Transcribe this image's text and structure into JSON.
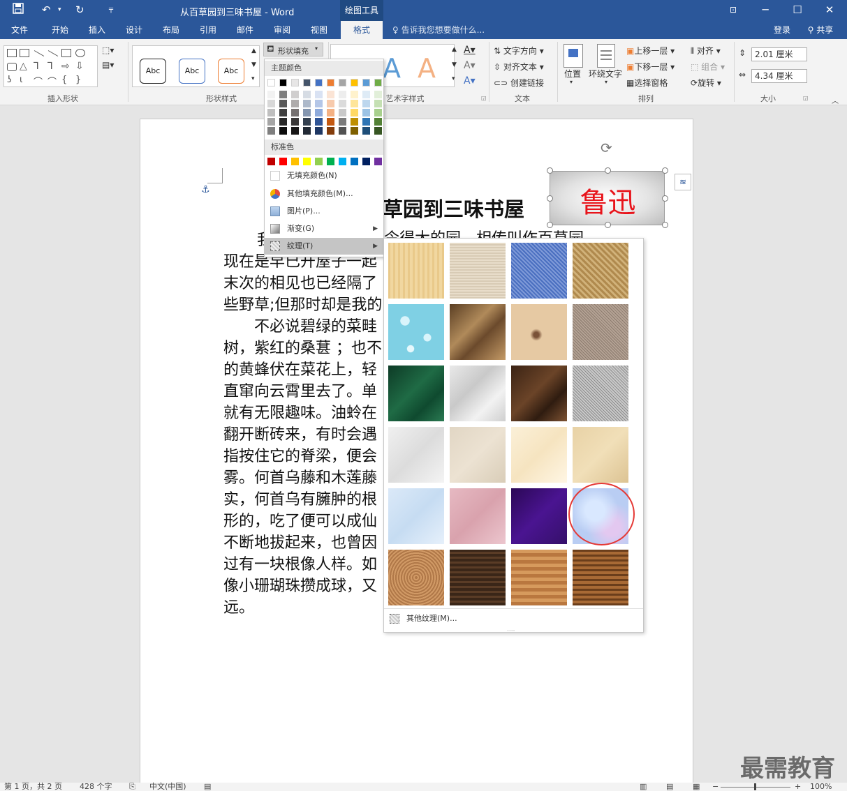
{
  "titlebar": {
    "save_icon": "save-icon",
    "undo_icon": "undo-icon",
    "redo_icon": "redo-icon",
    "qat_more_icon": "caret-down-icon",
    "doc_title": "从百草园到三味书屋 - Word",
    "context_tool": "绘图工具",
    "restore_ribbon_icon": "ribbon-display-icon",
    "minimize_icon": "minimize-icon",
    "maximize_icon": "maximize-icon",
    "close_icon": "close-icon"
  },
  "tabs": [
    "文件",
    "开始",
    "插入",
    "设计",
    "布局",
    "引用",
    "邮件",
    "审阅",
    "视图",
    "格式"
  ],
  "active_tab": "格式",
  "tell_me": "告诉我您想要做什么...",
  "login": "登录",
  "share": "共享",
  "ribbon": {
    "groups": [
      "插入形状",
      "形状样式",
      "艺术字样式",
      "文本",
      "排列",
      "大小"
    ],
    "shape_fill_label": "形状填充",
    "abc_styles": [
      "Abc",
      "Abc",
      "Abc"
    ],
    "text_direction": "文字方向",
    "align_text": "对齐文本",
    "create_link": "创建链接",
    "position": "位置",
    "wrap_text": "环绕文字",
    "bring_forward": "上移一层",
    "send_backward": "下移一层",
    "selection_pane": "选择窗格",
    "align": "对齐",
    "group": "组合",
    "rotate": "旋转",
    "height": "2.01 厘米",
    "width": "4.34 厘米",
    "wordart_letters": [
      "A",
      "A"
    ]
  },
  "fill_menu": {
    "theme_colors_label": "主题颜色",
    "standard_colors_label": "标准色",
    "theme_top_row": [
      "#ffffff",
      "#000000",
      "#e7e6e6",
      "#44546a",
      "#4472c4",
      "#ed7d31",
      "#a5a5a5",
      "#ffc000",
      "#5b9bd5",
      "#70ad47"
    ],
    "theme_shades": [
      [
        "#f2f2f2",
        "#7f7f7f",
        "#d0cece",
        "#d6dce4",
        "#d9e2f3",
        "#fbe4d5",
        "#ededed",
        "#fff2cc",
        "#deebf6",
        "#e2efd9"
      ],
      [
        "#d8d8d8",
        "#595959",
        "#aeabab",
        "#adb9ca",
        "#b4c6e7",
        "#f7caac",
        "#dbdbdb",
        "#fee599",
        "#bdd7ee",
        "#c5e0b3"
      ],
      [
        "#bfbfbf",
        "#3f3f3f",
        "#757070",
        "#8496b0",
        "#8eaadb",
        "#f4b183",
        "#c9c9c9",
        "#ffd965",
        "#9cc3e5",
        "#a8d08d"
      ],
      [
        "#a5a5a5",
        "#262626",
        "#3a3838",
        "#323f4f",
        "#2f5496",
        "#c45911",
        "#7b7b7b",
        "#bf8f00",
        "#2e75b5",
        "#538135"
      ],
      [
        "#7f7f7f",
        "#0c0c0c",
        "#171616",
        "#222a35",
        "#1f3864",
        "#833c0b",
        "#525252",
        "#7f6000",
        "#1e4e79",
        "#375623"
      ]
    ],
    "standard_colors": [
      "#c00000",
      "#ff0000",
      "#ffc000",
      "#ffff00",
      "#92d050",
      "#00b050",
      "#00b0f0",
      "#0070c0",
      "#002060",
      "#7030a0"
    ],
    "no_fill": "无填充颜色(N)",
    "more_colors": "其他填充颜色(M)...",
    "picture": "图片(P)...",
    "gradient": "渐变(G)",
    "texture": "纹理(T)"
  },
  "texture_menu": {
    "more_textures": "其他纹理(M)...",
    "selected_index": 19
  },
  "document": {
    "heading": "草园到三味书屋",
    "shape_text": "鲁迅",
    "lines": [
      "我",
      "现在是早已开屋子一起",
      "末次的相见也已经隔了",
      "些野草;但那时却是我的",
      "　　不必说碧绿的菜畦",
      "树，紫红的桑葚 ；也不",
      "的黄蜂伏在菜花上，轻",
      "直窜向云霄里去了。单",
      "就有无限趣味。油蛉在",
      "翻开断砖来，有时会遇",
      "指按住它的脊梁，便会",
      "雾。何首乌藤和木莲藤",
      "实，何首乌有臃肿的根",
      "形的，吃了便可以成仙",
      "不断地拔起来，也曾因",
      "过有一块根像人样。如",
      "像小珊瑚珠攒成球，又",
      "远。"
    ],
    "partial_line2_tail": "令得大的园，相传叫作百草园"
  },
  "status": {
    "page": "第 1 页，共 2 页",
    "words": "428 个字",
    "lang": "中文(中国)",
    "zoom": "100%"
  },
  "watermark": "最需教育"
}
